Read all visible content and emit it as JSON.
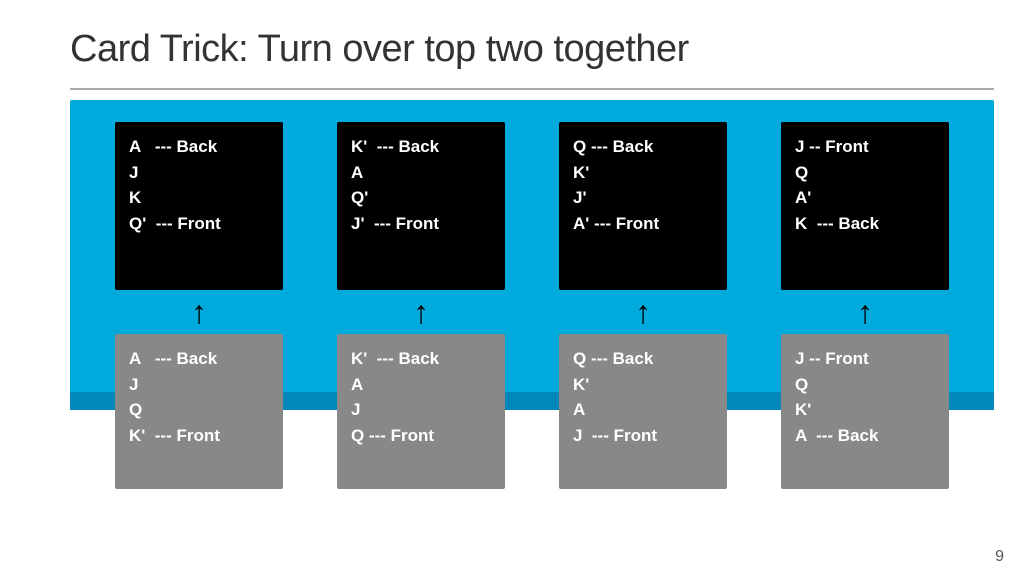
{
  "title": "Card Trick: Turn over top two together",
  "page_number": "9",
  "columns": [
    {
      "id": "col1",
      "top_lines": [
        "A   --- Back",
        "J",
        "K",
        "Q'  --- Front"
      ],
      "bottom_lines": [
        "A   --- Back",
        "J",
        "Q",
        "K'  --- Front"
      ]
    },
    {
      "id": "col2",
      "top_lines": [
        "K'  --- Back",
        "A",
        "Q'",
        "J'  --- Front"
      ],
      "bottom_lines": [
        "K'  --- Back",
        "A",
        "J",
        "Q --- Front"
      ]
    },
    {
      "id": "col3",
      "top_lines": [
        "Q --- Back",
        "K'",
        "J'",
        "A' --- Front"
      ],
      "bottom_lines": [
        "Q --- Back",
        "K'",
        "A",
        "J  --- Front"
      ]
    },
    {
      "id": "col4",
      "top_lines": [
        "J -- Front",
        "Q",
        "A'",
        "K  --- Back"
      ],
      "bottom_lines": [
        "J -- Front",
        "Q",
        "K'",
        "A  --- Back"
      ]
    }
  ]
}
